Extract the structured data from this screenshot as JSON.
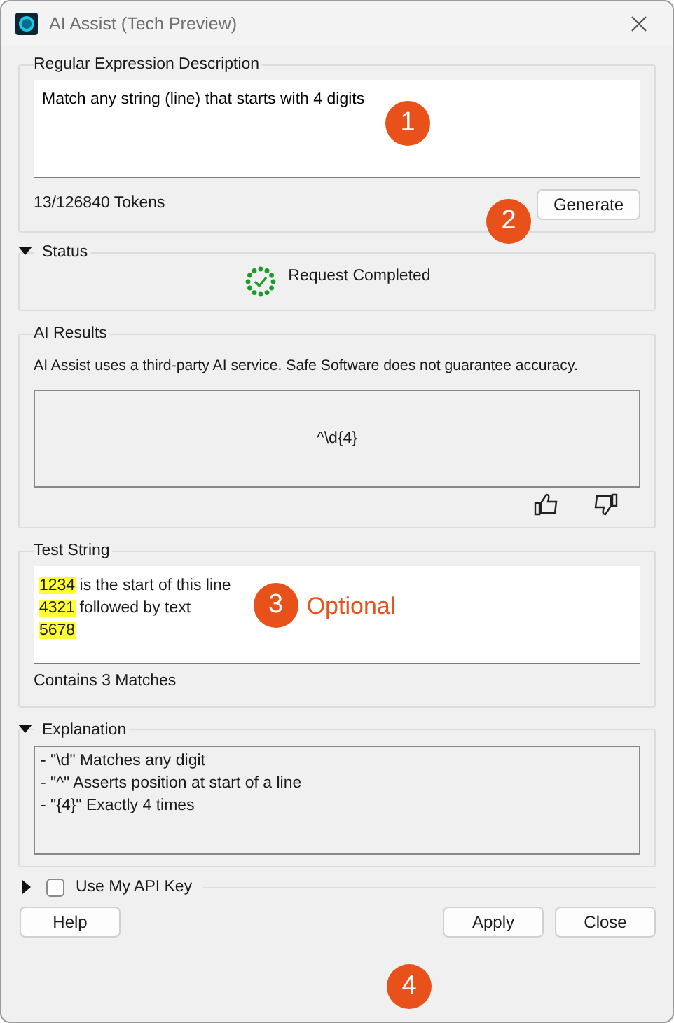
{
  "window": {
    "title": "AI Assist (Tech Preview)"
  },
  "description": {
    "legend": "Regular Expression Description",
    "value": "Match any string (line) that starts with 4 digits",
    "tokens": "13/126840 Tokens",
    "button": "Generate"
  },
  "status": {
    "legend": "Status",
    "expanded": true,
    "text": "Request Completed"
  },
  "results": {
    "legend": "AI Results",
    "notice": "AI Assist uses a third-party AI service. Safe Software does not guarantee accuracy.",
    "regex": "^\\d{4}"
  },
  "test_string": {
    "legend": "Test String",
    "lines": [
      {
        "match": "1234",
        "text": " is the start of this line"
      },
      {
        "match": "4321",
        "text": " followed by text"
      },
      {
        "match": "5678"
      }
    ],
    "summary": "Contains 3 Matches"
  },
  "explanation": {
    "legend": "Explanation",
    "expanded": true,
    "lines": [
      "- \"\\d\" Matches any digit",
      "- \"^\" Asserts position at start of a line",
      "- \"{4}\" Exactly 4 times"
    ]
  },
  "api_key": {
    "label": "Use My API Key",
    "expanded": false,
    "checked": false
  },
  "buttons": {
    "help": "Help",
    "apply": "Apply",
    "close": "Close"
  },
  "callouts": [
    {
      "number": "1"
    },
    {
      "number": "2"
    },
    {
      "number": "3",
      "label": "Optional"
    },
    {
      "number": "4"
    }
  ]
}
